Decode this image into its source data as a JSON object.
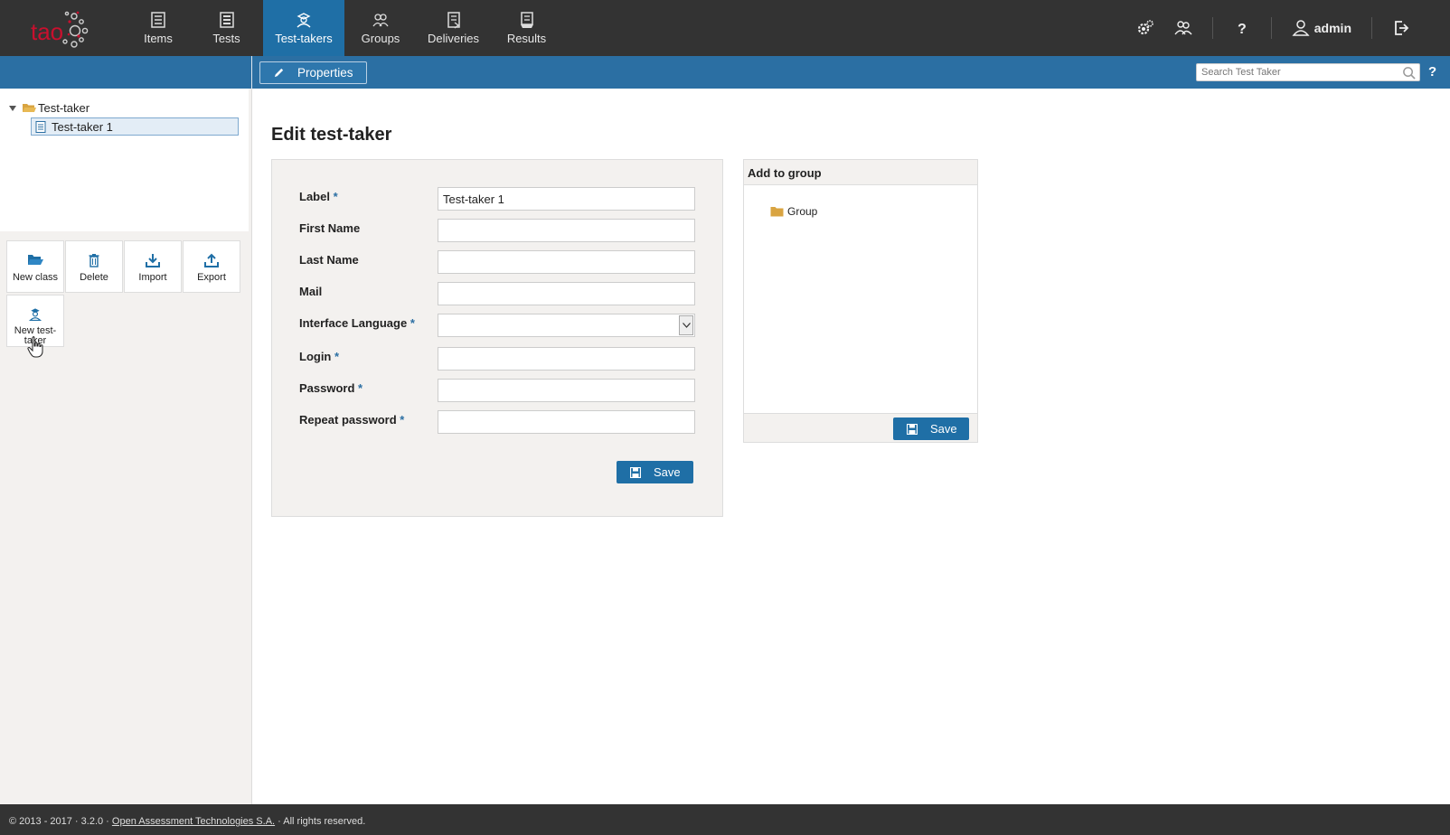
{
  "app": {
    "logo_text": "tao"
  },
  "nav": {
    "items": [
      {
        "label": "Items",
        "icon": "items-icon"
      },
      {
        "label": "Tests",
        "icon": "tests-icon"
      },
      {
        "label": "Test-takers",
        "icon": "test-taker-icon",
        "active": true
      },
      {
        "label": "Groups",
        "icon": "groups-icon"
      },
      {
        "label": "Deliveries",
        "icon": "deliveries-icon"
      },
      {
        "label": "Results",
        "icon": "results-icon"
      }
    ]
  },
  "user": {
    "name": "admin"
  },
  "actionbar": {
    "properties_label": "Properties",
    "search_placeholder": "Search Test Taker",
    "help": "?"
  },
  "tree": {
    "root_label": "Test-taker",
    "child_label": "Test-taker 1"
  },
  "toolbar": {
    "new_class": "New class",
    "delete": "Delete",
    "import": "Import",
    "export": "Export",
    "new_test_taker": "New test-taker"
  },
  "form": {
    "title": "Edit test-taker",
    "fields": {
      "label": {
        "label": "Label",
        "required": "*",
        "value": "Test-taker 1"
      },
      "first_name": {
        "label": "First Name",
        "value": ""
      },
      "last_name": {
        "label": "Last Name",
        "value": ""
      },
      "mail": {
        "label": "Mail",
        "value": ""
      },
      "interface_language": {
        "label": "Interface Language",
        "required": "*",
        "value": ""
      },
      "login": {
        "label": "Login",
        "required": "*",
        "value": ""
      },
      "password": {
        "label": "Password",
        "required": "*",
        "value": ""
      },
      "repeat_password": {
        "label": "Repeat password",
        "required": "*",
        "value": ""
      }
    },
    "save_label": "Save"
  },
  "group_panel": {
    "title": "Add to group",
    "group_label": "Group",
    "save_label": "Save"
  },
  "footer": {
    "prefix": "© 2013 - 2017 · 3.2.0 · ",
    "link": "Open Assessment Technologies S.A.",
    "suffix": " · All rights reserved."
  },
  "colors": {
    "topbar": "#333333",
    "accent_blue": "#1f6fa6",
    "folder": "#d9a441",
    "panel_bg": "#f3f1ef"
  }
}
